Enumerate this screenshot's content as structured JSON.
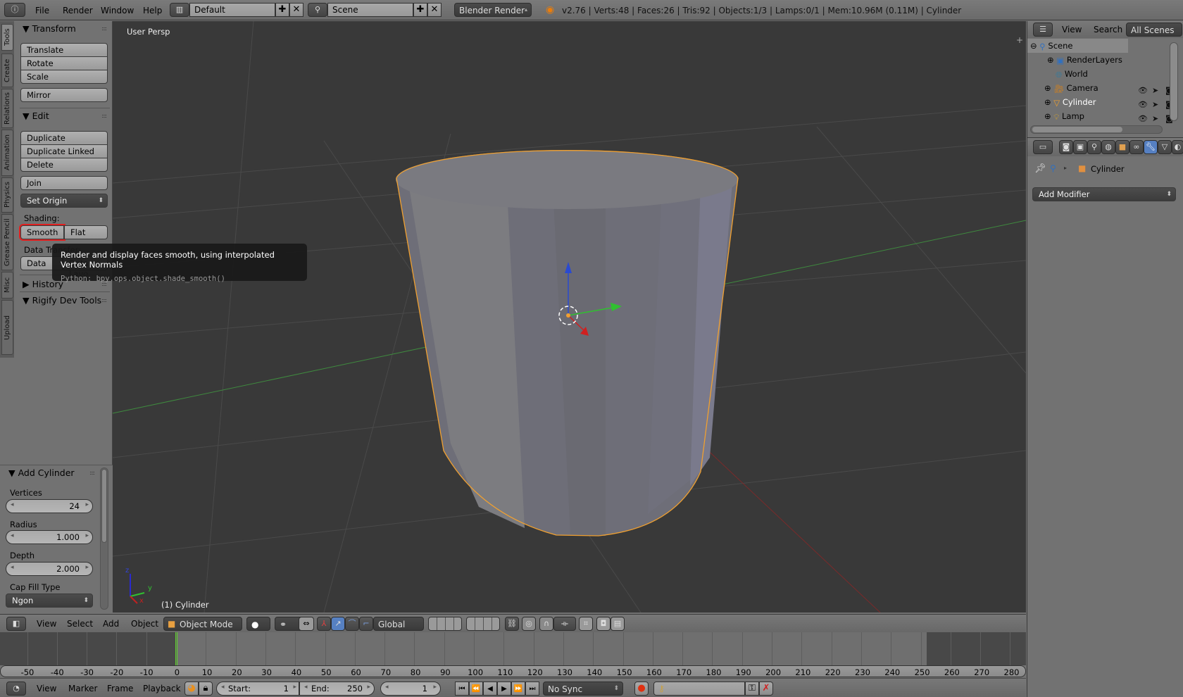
{
  "topbar": {
    "menus": [
      "File",
      "Render",
      "Window",
      "Help"
    ],
    "screen_layout": "Default",
    "scene": "Scene",
    "render_engine": "Blender Render",
    "status": "v2.76 | Verts:48 | Faces:26 | Tris:92 | Objects:1/3 | Lamps:0/1 | Mem:10.96M (0.11M) | Cylinder"
  },
  "tool_tabs": [
    "Tools",
    "Create",
    "Relations",
    "Animation",
    "Physics",
    "Grease Pencil",
    "Misc",
    "Upload"
  ],
  "toolshelf": {
    "transform": {
      "title": "Transform",
      "buttons": [
        "Translate",
        "Rotate",
        "Scale",
        "Mirror"
      ]
    },
    "edit": {
      "title": "Edit",
      "buttons": [
        "Duplicate",
        "Duplicate Linked",
        "Delete",
        "Join"
      ],
      "set_origin": "Set Origin"
    },
    "shading_label": "Shading:",
    "shading_smooth": "Smooth",
    "shading_flat": "Flat",
    "data_transfer_label": "Data Transfer:",
    "data_button": "Data",
    "data_layout_button": "Data Layo",
    "history": "History",
    "rigify": "Rigify Dev Tools"
  },
  "tooltip": {
    "text": "Render and display faces smooth, using interpolated Vertex Normals",
    "python": "Python: bpy.ops.object.shade_smooth()"
  },
  "operator_panel": {
    "title": "Add Cylinder",
    "vertices_label": "Vertices",
    "vertices": "24",
    "radius_label": "Radius",
    "radius": "1.000",
    "depth_label": "Depth",
    "depth": "2.000",
    "cap_fill_label": "Cap Fill Type",
    "cap_fill": "Ngon"
  },
  "viewport": {
    "view_name": "User Persp",
    "object_label": "(1) Cylinder",
    "axis_x": "x",
    "axis_y": "y",
    "axis_z": "z"
  },
  "view3d_header": {
    "menus": [
      "View",
      "Select",
      "Add",
      "Object"
    ],
    "mode": "Object Mode",
    "orientation": "Global"
  },
  "timeline": {
    "ticks": [
      "-50",
      "-40",
      "-30",
      "-20",
      "-10",
      "0",
      "10",
      "20",
      "30",
      "40",
      "50",
      "60",
      "70",
      "80",
      "90",
      "100",
      "110",
      "120",
      "130",
      "140",
      "150",
      "160",
      "170",
      "180",
      "190",
      "200",
      "210",
      "220",
      "230",
      "240",
      "250",
      "260",
      "270",
      "280"
    ],
    "current_frame": 1,
    "menus": [
      "View",
      "Marker",
      "Frame",
      "Playback"
    ],
    "start_label": "Start:",
    "start": "1",
    "end_label": "End:",
    "end": "250",
    "frame": "1",
    "sync": "No Sync"
  },
  "outliner": {
    "header": {
      "view": "View",
      "search": "Search",
      "filter": "All Scenes"
    },
    "items": [
      {
        "name": "Scene",
        "icon": "scene-icon"
      },
      {
        "name": "RenderLayers",
        "icon": "renderlayers-icon"
      },
      {
        "name": "World",
        "icon": "world-icon"
      },
      {
        "name": "Camera",
        "icon": "camera-icon"
      },
      {
        "name": "Cylinder",
        "icon": "mesh-icon"
      },
      {
        "name": "Lamp",
        "icon": "lamp-icon"
      }
    ]
  },
  "properties": {
    "context_object": "Cylinder",
    "add_modifier": "Add Modifier"
  },
  "colors": {
    "selection_outline": "#f0a030",
    "active_tab": "#5680c2",
    "highlight_red": "#e02020"
  }
}
